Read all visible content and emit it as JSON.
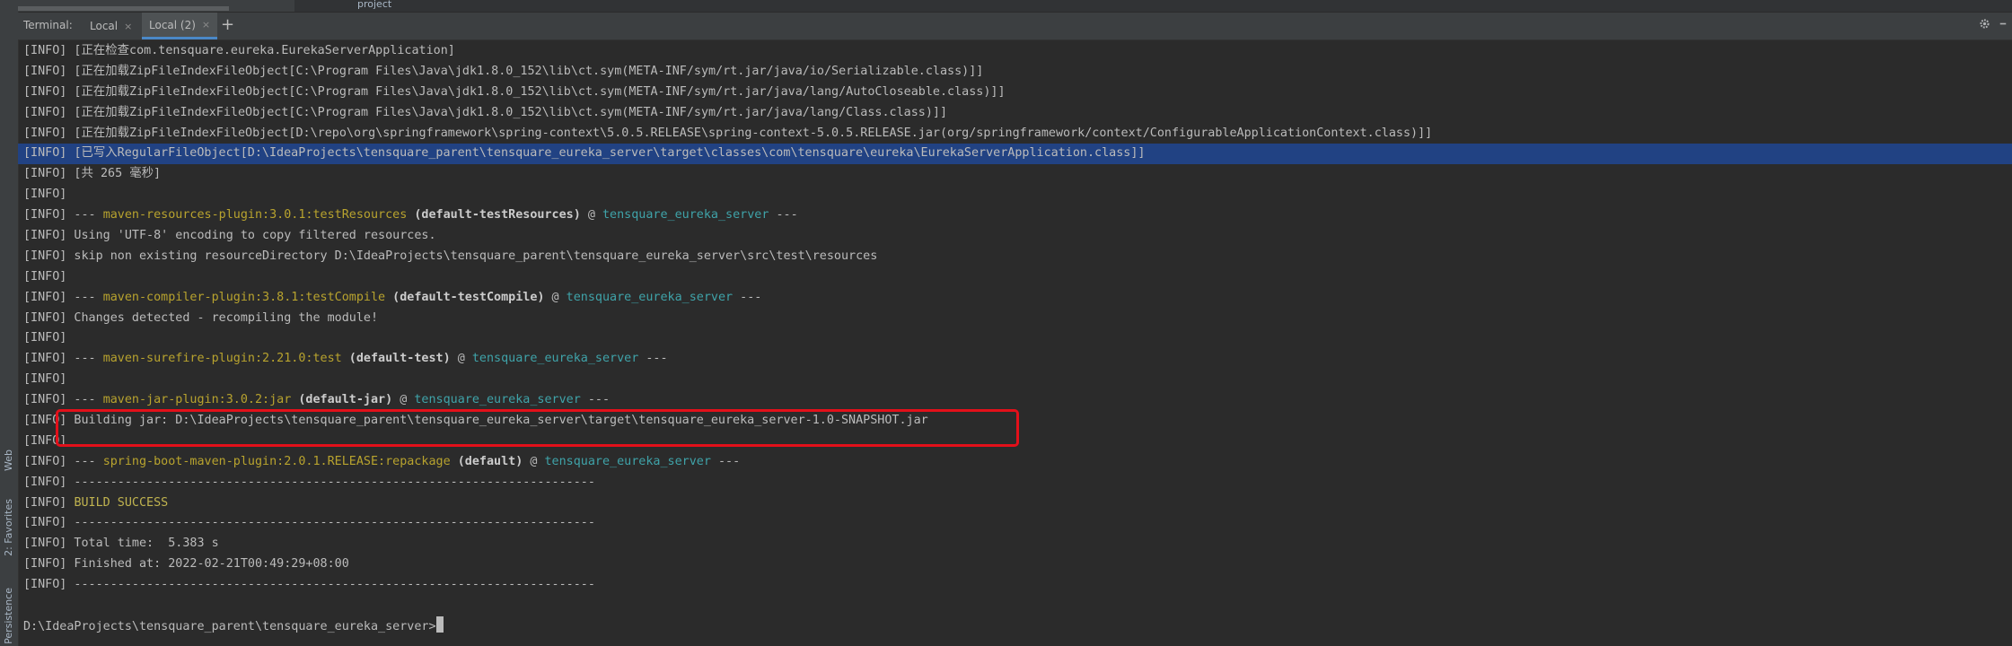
{
  "project_strip": {
    "label": "project"
  },
  "tabbar": {
    "title": "Terminal:",
    "tabs": [
      {
        "label": "Local",
        "close": "×"
      },
      {
        "label": "Local (2)",
        "close": "×"
      }
    ],
    "add": "+",
    "settings_icon": "gear-icon",
    "minimize_icon": "minimize-icon"
  },
  "side_tabs": {
    "web": "Web",
    "favorites": "2: Favorites",
    "persistence": "Persistence"
  },
  "terminal": {
    "lines": [
      {
        "t": "plain",
        "text": "[INFO] [正在检查com.tensquare.eureka.EurekaServerApplication]"
      },
      {
        "t": "plain",
        "text": "[INFO] [正在加载ZipFileIndexFileObject[C:\\Program Files\\Java\\jdk1.8.0_152\\lib\\ct.sym(META-INF/sym/rt.jar/java/io/Serializable.class)]]"
      },
      {
        "t": "plain",
        "text": "[INFO] [正在加载ZipFileIndexFileObject[C:\\Program Files\\Java\\jdk1.8.0_152\\lib\\ct.sym(META-INF/sym/rt.jar/java/lang/AutoCloseable.class)]]"
      },
      {
        "t": "plain",
        "text": "[INFO] [正在加载ZipFileIndexFileObject[C:\\Program Files\\Java\\jdk1.8.0_152\\lib\\ct.sym(META-INF/sym/rt.jar/java/lang/Class.class)]]"
      },
      {
        "t": "plain",
        "text": "[INFO] [正在加载ZipFileIndexFileObject[D:\\repo\\org\\springframework\\spring-context\\5.0.5.RELEASE\\spring-context-5.0.5.RELEASE.jar(org/springframework/context/ConfigurableApplicationContext.class)]]"
      },
      {
        "t": "sel",
        "prefix": "[INFO] ",
        "text": "[已写入RegularFileObject[D:\\IdeaProjects\\tensquare_parent\\tensquare_eureka_server\\target\\classes\\com\\tensquare\\eureka\\EurekaServerApplication.class]]"
      },
      {
        "t": "plain",
        "text": "[INFO] [共 265 毫秒]"
      },
      {
        "t": "plain",
        "text": "[INFO]"
      },
      {
        "t": "mvn",
        "plugin": "maven-resources-plugin:3.0.1:testResources",
        "goal": "(default-testResources)",
        "proj": "tensquare_eureka_server"
      },
      {
        "t": "plain",
        "text": "[INFO] Using 'UTF-8' encoding to copy filtered resources."
      },
      {
        "t": "plain",
        "text": "[INFO] skip non existing resourceDirectory D:\\IdeaProjects\\tensquare_parent\\tensquare_eureka_server\\src\\test\\resources"
      },
      {
        "t": "plain",
        "text": "[INFO]"
      },
      {
        "t": "mvn",
        "plugin": "maven-compiler-plugin:3.8.1:testCompile",
        "goal": "(default-testCompile)",
        "proj": "tensquare_eureka_server"
      },
      {
        "t": "plain",
        "text": "[INFO] Changes detected - recompiling the module!"
      },
      {
        "t": "plain",
        "text": "[INFO]"
      },
      {
        "t": "mvn",
        "plugin": "maven-surefire-plugin:2.21.0:test",
        "goal": "(default-test)",
        "proj": "tensquare_eureka_server"
      },
      {
        "t": "plain",
        "text": "[INFO]"
      },
      {
        "t": "mvn",
        "plugin": "maven-jar-plugin:3.0.2:jar",
        "goal": "(default-jar)",
        "proj": "tensquare_eureka_server"
      },
      {
        "t": "plain",
        "text": "[INFO] Building jar: D:\\IdeaProjects\\tensquare_parent\\tensquare_eureka_server\\target\\tensquare_eureka_server-1.0-SNAPSHOT.jar"
      },
      {
        "t": "plain",
        "text": "[INFO]"
      },
      {
        "t": "mvn",
        "plugin": "spring-boot-maven-plugin:2.0.1.RELEASE:repackage",
        "goal": "(default)",
        "proj": "tensquare_eureka_server"
      },
      {
        "t": "plain",
        "text": "[INFO] ------------------------------------------------------------------------"
      },
      {
        "t": "succ",
        "prefix": "[INFO] ",
        "text": "BUILD SUCCESS"
      },
      {
        "t": "plain",
        "text": "[INFO] ------------------------------------------------------------------------"
      },
      {
        "t": "plain",
        "text": "[INFO] Total time:  5.383 s"
      },
      {
        "t": "plain",
        "text": "[INFO] Finished at: 2022-02-21T00:49:29+08:00"
      },
      {
        "t": "plain",
        "text": "[INFO] ------------------------------------------------------------------------"
      },
      {
        "t": "plain",
        "text": ""
      },
      {
        "t": "prompt",
        "text": "D:\\IdeaProjects\\tensquare_parent\\tensquare_eureka_server>"
      }
    ]
  },
  "colors": {
    "background": "#2b2b2b",
    "plugin": "#b8a32e",
    "project": "#3fa3a9",
    "selection": "#214283",
    "highlight_box": "#e3101a"
  }
}
